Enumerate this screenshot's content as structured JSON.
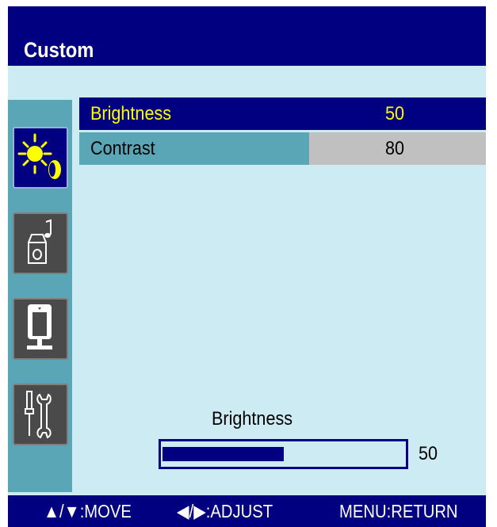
{
  "menu": {
    "title": "Custom"
  },
  "sidebar": {
    "tabs": [
      {
        "name": "picture",
        "icon": "brightness-contrast-icon",
        "active": true
      },
      {
        "name": "audio",
        "icon": "audio-device-icon",
        "active": false
      },
      {
        "name": "display",
        "icon": "monitor-adjust-icon",
        "active": false
      },
      {
        "name": "tools",
        "icon": "screwdriver-wrench-icon",
        "active": false
      }
    ]
  },
  "settings": [
    {
      "label": "Brightness",
      "value": "50",
      "selected": true
    },
    {
      "label": "Contrast",
      "value": "80",
      "selected": false
    }
  ],
  "slider": {
    "label": "Brightness",
    "value": "50",
    "fraction": 0.5
  },
  "footer": {
    "move_hint": "▲/▼:MOVE",
    "adjust_hint": "◀/▶:ADJUST",
    "return_hint": "MENU:RETURN"
  },
  "colors": {
    "header": "#000080",
    "panel": "#cdebf3",
    "sidebar": "#5aa6b6",
    "selected_text": "#ffff00",
    "value_bg": "#c0c0c0"
  }
}
